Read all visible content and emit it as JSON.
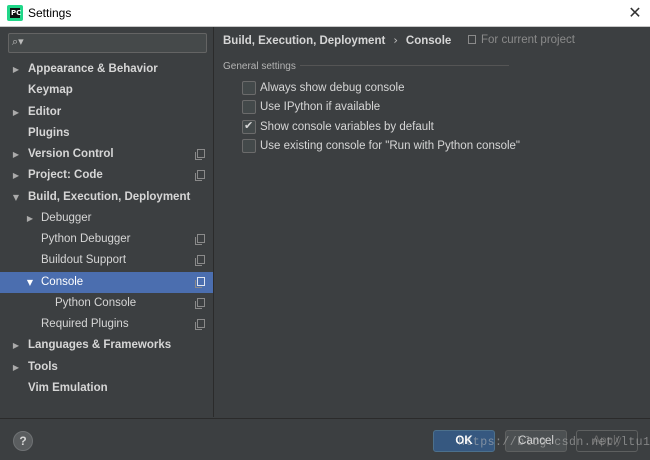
{
  "window": {
    "title": "Settings",
    "logo_text": "PC",
    "close_glyph": "✕"
  },
  "search": {
    "value": "",
    "icon": "search-icon"
  },
  "tree": {
    "items": [
      {
        "label": "Appearance & Behavior",
        "arrow": "▶"
      },
      {
        "label": "Keymap",
        "arrow": ""
      },
      {
        "label": "Editor",
        "arrow": "▶"
      },
      {
        "label": "Plugins",
        "arrow": ""
      },
      {
        "label": "Version Control",
        "arrow": "▶"
      },
      {
        "label": "Project: Code",
        "arrow": "▶"
      },
      {
        "label": "Build, Execution, Deployment",
        "arrow": "▼"
      },
      {
        "label": "Debugger",
        "arrow": "▶"
      },
      {
        "label": "Python Debugger",
        "arrow": ""
      },
      {
        "label": "Buildout Support",
        "arrow": ""
      },
      {
        "label": "Console",
        "arrow": "▼"
      },
      {
        "label": "Python Console",
        "arrow": ""
      },
      {
        "label": "Required Plugins",
        "arrow": ""
      },
      {
        "label": "Languages & Frameworks",
        "arrow": "▶"
      },
      {
        "label": "Tools",
        "arrow": "▶"
      },
      {
        "label": "Vim Emulation",
        "arrow": ""
      }
    ],
    "selected": "Console"
  },
  "breadcrumb": {
    "parent": "Build, Execution, Deployment",
    "separator": "›",
    "current": "Console"
  },
  "scope_note": "For current project",
  "section": {
    "title": "General settings"
  },
  "options": [
    {
      "label": "Always show debug console",
      "checked": false
    },
    {
      "label": "Use IPython if available",
      "checked": false
    },
    {
      "label": "Show console variables by default",
      "checked": true
    },
    {
      "label": "Use existing console for \"Run with Python console\"",
      "checked": false
    }
  ],
  "footer": {
    "help_label": "?",
    "ok_label": "OK",
    "cancel_label": "Cancel",
    "apply_label": "Apply",
    "watermark": "https://blog.csdn.net/ltu15"
  },
  "colors": {
    "background": "#3c3f41",
    "selection": "#4b6eaf",
    "ok_button": "#365880"
  }
}
